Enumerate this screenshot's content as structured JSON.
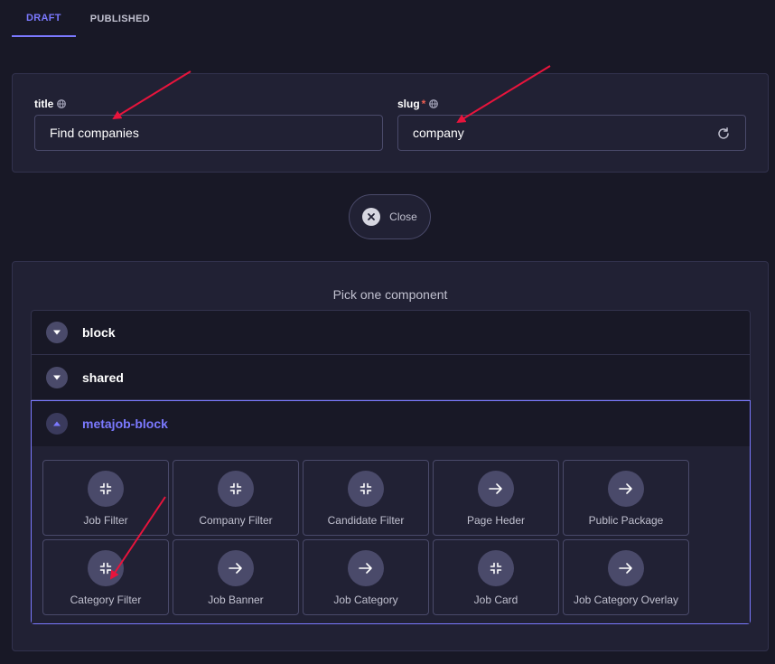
{
  "tabs": [
    {
      "label": "DRAFT",
      "active": true
    },
    {
      "label": "PUBLISHED",
      "active": false
    }
  ],
  "fields": {
    "title": {
      "label": "title",
      "value": "Find companies",
      "required": false
    },
    "slug": {
      "label": "slug",
      "required_mark": "*",
      "value": "company"
    }
  },
  "close_button": {
    "label": "Close"
  },
  "picker": {
    "title": "Pick one component",
    "categories": [
      {
        "label": "block",
        "expanded": false
      },
      {
        "label": "shared",
        "expanded": false
      },
      {
        "label": "metajob-block",
        "expanded": true
      }
    ],
    "components": [
      {
        "label": "Job Filter",
        "icon": "collapse-icon"
      },
      {
        "label": "Company Filter",
        "icon": "collapse-icon"
      },
      {
        "label": "Candidate Filter",
        "icon": "collapse-icon"
      },
      {
        "label": "Page Heder",
        "icon": "arrow-right-icon"
      },
      {
        "label": "Public Package",
        "icon": "arrow-right-icon"
      },
      {
        "label": "Category Filter",
        "icon": "collapse-icon"
      },
      {
        "label": "Job Banner",
        "icon": "arrow-right-icon"
      },
      {
        "label": "Job Category",
        "icon": "arrow-right-icon"
      },
      {
        "label": "Job Card",
        "icon": "collapse-icon"
      },
      {
        "label": "Job Category Overlay",
        "icon": "arrow-right-icon"
      }
    ]
  },
  "colors": {
    "background": "#181826",
    "card": "#212134",
    "accent": "#7b79ff",
    "annotation": "#e8143c"
  }
}
